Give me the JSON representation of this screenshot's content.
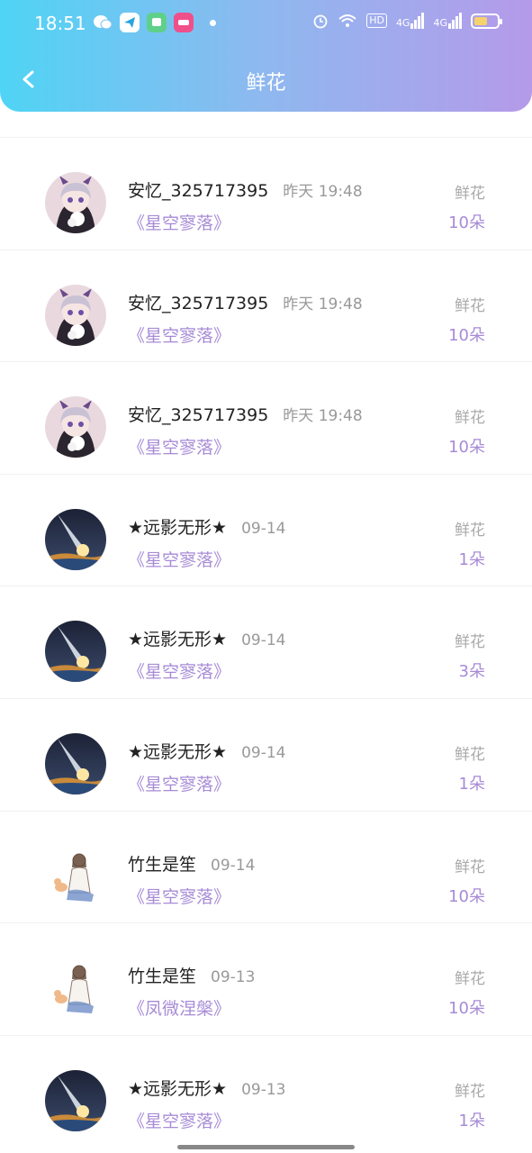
{
  "status_bar": {
    "time": "18:51",
    "network_hd": "HD",
    "signal_1": "4G",
    "signal_2": "4G"
  },
  "header": {
    "title": "鲜花"
  },
  "records": [
    {
      "name": "安忆_325717395",
      "date": "昨天 19:48",
      "book": "《星空寥落》",
      "gift": "鲜花",
      "count": "10朵",
      "avatar": "anime-girl"
    },
    {
      "name": "安忆_325717395",
      "date": "昨天 19:48",
      "book": "《星空寥落》",
      "gift": "鲜花",
      "count": "10朵",
      "avatar": "anime-girl"
    },
    {
      "name": "安忆_325717395",
      "date": "昨天 19:48",
      "book": "《星空寥落》",
      "gift": "鲜花",
      "count": "10朵",
      "avatar": "anime-girl"
    },
    {
      "name": "★远影无形★",
      "date": "09-14",
      "book": "《星空寥落》",
      "gift": "鲜花",
      "count": "1朵",
      "avatar": "meteor"
    },
    {
      "name": "★远影无形★",
      "date": "09-14",
      "book": "《星空寥落》",
      "gift": "鲜花",
      "count": "3朵",
      "avatar": "meteor"
    },
    {
      "name": "★远影无形★",
      "date": "09-14",
      "book": "《星空寥落》",
      "gift": "鲜花",
      "count": "1朵",
      "avatar": "meteor"
    },
    {
      "name": "竹生是笙",
      "date": "09-14",
      "book": "《星空寥落》",
      "gift": "鲜花",
      "count": "10朵",
      "avatar": "sketch-girl"
    },
    {
      "name": "竹生是笙",
      "date": "09-13",
      "book": "《凤微涅槃》",
      "gift": "鲜花",
      "count": "10朵",
      "avatar": "sketch-girl"
    },
    {
      "name": "★远影无形★",
      "date": "09-13",
      "book": "《星空寥落》",
      "gift": "鲜花",
      "count": "1朵",
      "avatar": "meteor"
    }
  ],
  "colors": {
    "accent": "#a78bd6",
    "header_start": "#4fd4f5",
    "header_end": "#b59aea"
  }
}
